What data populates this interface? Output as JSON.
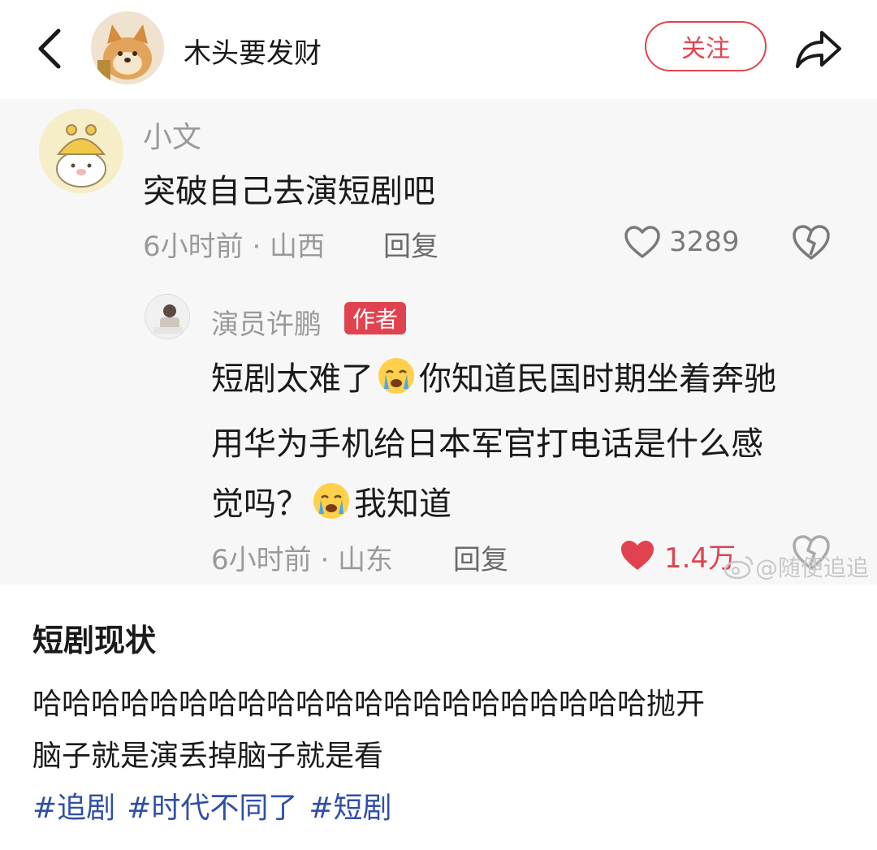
{
  "header": {
    "author_name": "木头要发财",
    "follow_label": "关注"
  },
  "comment": {
    "user": "小文",
    "text": "突破自己去演短剧吧",
    "meta": "6小时前 · 山西",
    "reply_label": "回复",
    "likes": "3289"
  },
  "reply": {
    "user": "演员许鹏",
    "badge": "作者",
    "line1_a": "短剧太难了",
    "line1_b": "你知道民国时期坐着奔驰",
    "line2": "用华为手机给日本军官打电话是什么感",
    "line3_a": "觉吗？",
    "line3_b": "我知道",
    "meta": "6小时前 · 山东",
    "reply_label": "回复",
    "likes": "1.4万"
  },
  "watermark": "@随便追追",
  "post": {
    "title": "短剧现状",
    "line1": "哈哈哈哈哈哈哈哈哈哈哈哈哈哈哈哈哈哈哈哈哈抛开",
    "line2": "脑子就是演丢掉脑子就是看",
    "tags": [
      "#追剧",
      "#时代不同了",
      "#短剧"
    ]
  },
  "colors": {
    "accent": "#e0434f",
    "tag": "#2f4fa8",
    "muted": "#9a9a9a"
  }
}
